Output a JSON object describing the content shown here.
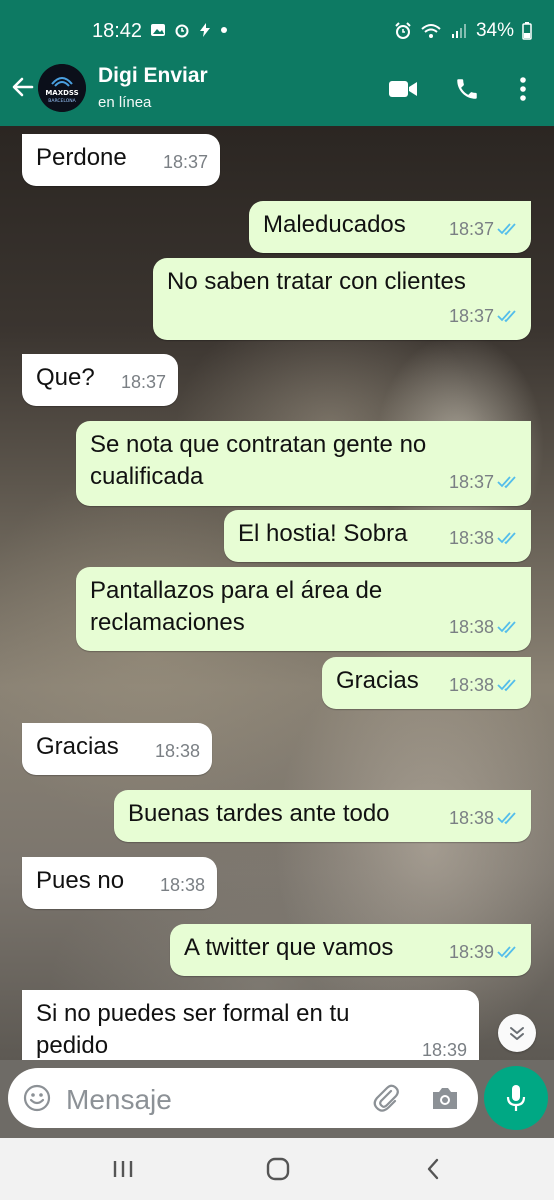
{
  "status_bar": {
    "time": "18:42",
    "battery": "34%"
  },
  "header": {
    "contact_name": "Digi Enviar",
    "contact_status": "en línea",
    "avatar_text_1": "MAXDSS",
    "avatar_text_2": "BARCELONA"
  },
  "messages": [
    {
      "dir": "in",
      "text": "Perdone",
      "time": "18:37"
    },
    {
      "dir": "out",
      "text": "Maleducados",
      "time": "18:37",
      "read": true
    },
    {
      "dir": "out",
      "text": "No saben tratar con clientes",
      "time": "18:37",
      "read": true
    },
    {
      "dir": "in",
      "text": "Que?",
      "time": "18:37"
    },
    {
      "dir": "out",
      "text": "Se nota que contratan gente no cualificada",
      "time": "18:37",
      "read": true
    },
    {
      "dir": "out",
      "text": "El hostia! Sobra",
      "time": "18:38",
      "read": true
    },
    {
      "dir": "out",
      "text": "Pantallazos para el área de reclamaciones",
      "time": "18:38",
      "read": true
    },
    {
      "dir": "out",
      "text": "Gracias",
      "time": "18:38",
      "read": true
    },
    {
      "dir": "in",
      "text": "Gracias",
      "time": "18:38"
    },
    {
      "dir": "out",
      "text": "Buenas tardes ante todo",
      "time": "18:38",
      "read": true
    },
    {
      "dir": "in",
      "text": "Pues no",
      "time": "18:38"
    },
    {
      "dir": "out",
      "text": "A twitter que vamos",
      "time": "18:39",
      "read": true
    },
    {
      "dir": "in",
      "text": "Si no puedes ser formal en tu pedido",
      "time": "18:39"
    }
  ],
  "input": {
    "placeholder": "Mensaje"
  },
  "colors": {
    "header": "#0d7a63",
    "outgoing": "#e7fdd4",
    "incoming": "#ffffff",
    "accent": "#00a884",
    "read_ticks": "#53bdeb"
  },
  "icons": {
    "header": [
      "back-arrow-icon",
      "video-call-icon",
      "phone-icon",
      "more-options-icon"
    ],
    "input": [
      "emoji-icon",
      "attach-icon",
      "camera-icon",
      "mic-icon"
    ],
    "nav": [
      "recent-apps-icon",
      "home-icon",
      "back-icon"
    ]
  }
}
